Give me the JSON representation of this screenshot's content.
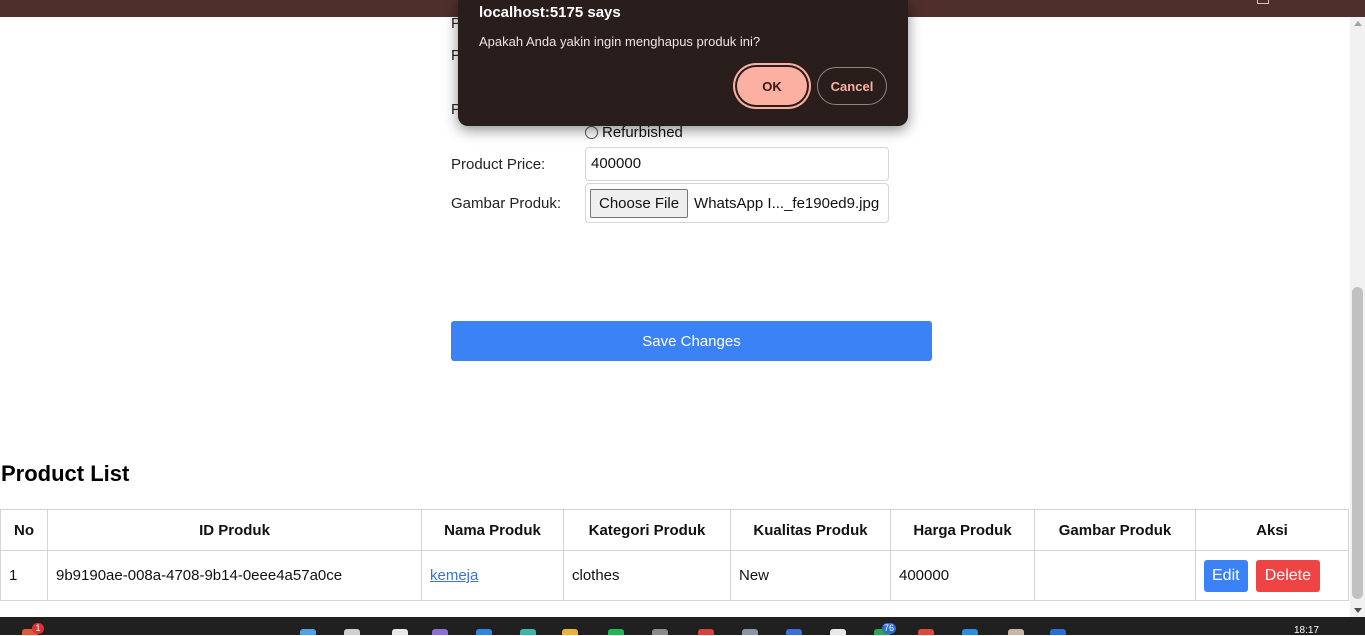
{
  "dialog": {
    "title": "localhost:5175 says",
    "message": "Apakah Anda yakin ingin menghapus produk ini?",
    "ok_label": "OK",
    "cancel_label": "Cancel"
  },
  "form": {
    "partial_labels": [
      "P",
      "P",
      "P"
    ],
    "radio_option": "Refurbished",
    "price_label": "Product Price:",
    "price_value": "400000",
    "image_label": "Gambar Produk:",
    "choose_file_label": "Choose File",
    "file_name": "WhatsApp I..._fe190ed9.jpg",
    "save_label": "Save Changes"
  },
  "product_list": {
    "title": "Product List",
    "headers": [
      "No",
      "ID Produk",
      "Nama Produk",
      "Kategori Produk",
      "Kualitas Produk",
      "Harga Produk",
      "Gambar Produk",
      "Aksi"
    ],
    "rows": [
      {
        "no": "1",
        "id": "9b9190ae-008a-4708-9b14-0eee4a57a0ce",
        "name": "kemeja",
        "category": "clothes",
        "quality": "New",
        "price": "400000",
        "image": "",
        "edit_label": "Edit",
        "delete_label": "Delete"
      }
    ]
  },
  "taskbar": {
    "clock": "18:17",
    "badges": [
      "1",
      "76"
    ]
  },
  "colors": {
    "browser_bar": "#4e2f2b",
    "dialog_bg": "#2a1e1d",
    "dialog_accent": "#fcb0a2",
    "primary_button": "#3b82f6",
    "danger_button": "#ef4444"
  }
}
